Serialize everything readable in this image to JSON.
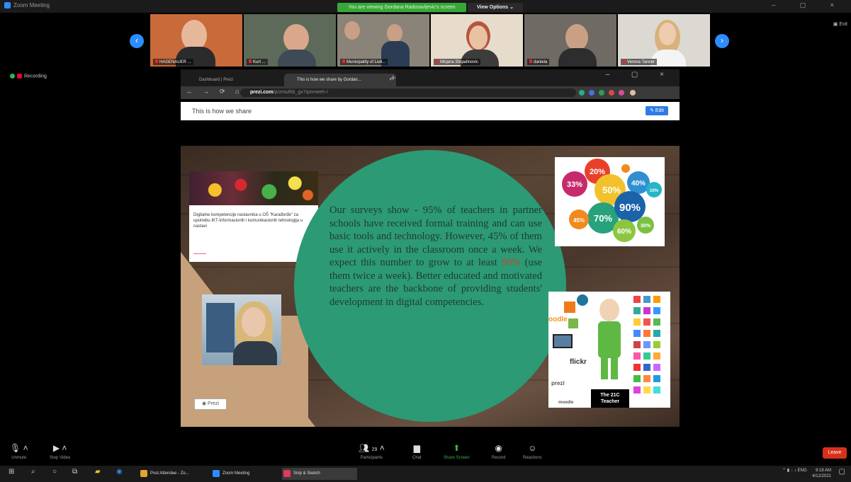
{
  "window": {
    "title": "Zoom Meeting"
  },
  "share_banner": {
    "text": "You are viewing Gordana Radosavljevic's screen",
    "view_options": "View Options ⌄"
  },
  "exit_label": "▣ Exit",
  "participants": [
    {
      "name": "HAGENAUER ..."
    },
    {
      "name": "Kurt ..."
    },
    {
      "name": "Municipality of Lieli..."
    },
    {
      "name": "Mirjana Stojadinovic"
    },
    {
      "name": "daniela"
    },
    {
      "name": "Verena Tanner"
    }
  ],
  "recording": {
    "label": "Recording"
  },
  "browser": {
    "tabs": [
      {
        "label": "Dashboard | Prezi",
        "close": "×"
      },
      {
        "label": "This is how we share by Gordan...",
        "close": "×"
      }
    ],
    "new_tab": "+",
    "url_host": "prezi.com",
    "url_path": "/p/zmuthb_gx7qmmeeh-/",
    "window_controls": "– ▢ ×"
  },
  "prezi": {
    "title": "This is how we share",
    "edit_label": "✎ Edit",
    "card_text": "Digitalne kompetencije nastavnika u OŠ \"Karađorđe\" za upotrebu IKT-Informacionih i komunikacionih tehnologija u nastavi",
    "body_before": "Our surveys show - 95% of teachers in partner schools have received formal training and can use basic tools and technology. However, 45% of them use it actively in the classroom once a week. We expect this number to grow to at least ",
    "body_highlight": "90%",
    "body_after": " (use them twice a week). Better educated and motivated teachers are the backbone of providing students' development in digital competencies.",
    "stat_bubbles": [
      {
        "label": "20%",
        "color": "#e8412b"
      },
      {
        "label": "33%",
        "color": "#c72a6b"
      },
      {
        "label": "50%",
        "color": "#f3c12c"
      },
      {
        "label": "40%",
        "color": "#2f8fd0"
      },
      {
        "label": "70%",
        "color": "#27a27c"
      },
      {
        "label": "90%",
        "color": "#1b63a8"
      },
      {
        "label": "60%",
        "color": "#8cc63f"
      },
      {
        "label": "45%",
        "color": "#f08a1e"
      },
      {
        "label": "30%",
        "color": "#7ac142"
      },
      {
        "label": "10%",
        "color": "#26b5c8"
      }
    ],
    "teacher_label_1": "The 21C",
    "teacher_label_2": "Teacher",
    "app_words": [
      "oodle",
      "flickr",
      "prezi",
      "moodle"
    ],
    "prezi_logo": "◉ Prezi"
  },
  "toolbar": {
    "unmute": "Unmute",
    "stop_video": "Stop Video",
    "participants": "Participants",
    "participants_count": "29",
    "chat": "Chat",
    "share_screen": "Share Screen",
    "record": "Record",
    "reactions": "Reactions",
    "end": "Leave"
  },
  "taskbar": {
    "apps": [
      {
        "label": "Post Attendee - Zo...",
        "color": "#e0a82a"
      },
      {
        "label": "Zoom Meeting",
        "color": "#2d8cff"
      },
      {
        "label": "Snip & Sketch",
        "color": "#e03a5c"
      }
    ],
    "lang": "ENG",
    "time": "9:18 AM",
    "date": "4/12/2021"
  },
  "colors": {
    "accent": "#2d8cff",
    "circle": "#2c9a75",
    "end": "#d9301c"
  }
}
